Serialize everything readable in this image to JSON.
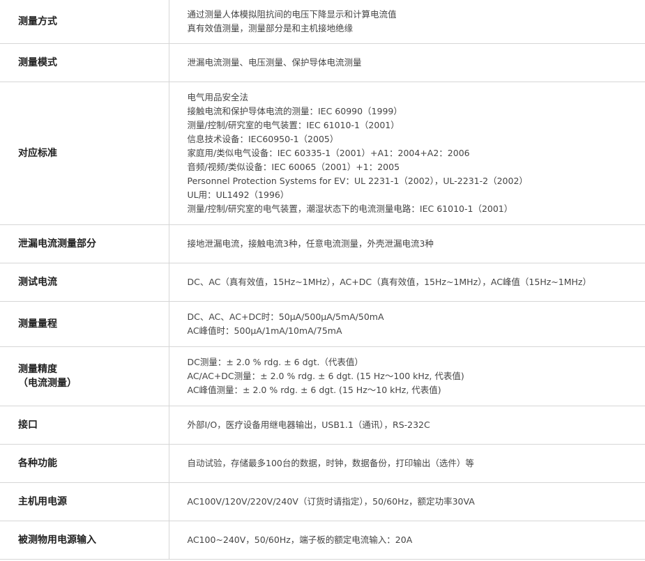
{
  "rows": [
    {
      "label": [
        "测量方式"
      ],
      "lines": [
        "通过测量人体模拟阻抗间的电压下降显示和计算电流值",
        "真有效值测量，测量部分是和主机接地绝缘"
      ]
    },
    {
      "label": [
        "测量模式"
      ],
      "lines": [
        "泄漏电流测量、电压测量、保护导体电流测量"
      ]
    },
    {
      "label": [
        "对应标准"
      ],
      "lines": [
        "电气用品安全法",
        "接触电流和保护导体电流的测量：IEC 60990（1999）",
        "测量/控制/研究室的电气装置：IEC 61010-1（2001）",
        "信息技术设备：IEC60950-1（2005）",
        "家庭用/类似电气设备：IEC 60335-1（2001）+A1：2004+A2：2006",
        "音频/视频/类似设备：IEC 60065（2001）+1：2005",
        "Personnel Protection Systems for EV：UL 2231-1（2002），UL-2231-2（2002）",
        "UL用：UL1492（1996）",
        "测量/控制/研究室的电气装置，潮湿状态下的电流测量电路：IEC 61010-1（2001）"
      ]
    },
    {
      "label": [
        "泄漏电流测量部分"
      ],
      "lines": [
        "接地泄漏电流，接触电流3种，任意电流测量，外壳泄漏电流3种"
      ]
    },
    {
      "label": [
        "测试电流"
      ],
      "lines": [
        "DC、AC（真有效值，15Hz~1MHz），AC+DC（真有效值，15Hz~1MHz），AC峰值（15Hz~1MHz）"
      ]
    },
    {
      "label": [
        "测量量程"
      ],
      "lines": [
        "DC、AC、AC+DC时：50μA/500μA/5mA/50mA",
        "AC峰值时：500μA/1mA/10mA/75mA"
      ]
    },
    {
      "label": [
        "测量精度",
        "（电流测量）"
      ],
      "lines": [
        "DC测量：± 2.0 % rdg. ± 6 dgt.（代表值）",
        "AC/AC+DC测量：± 2.0 % rdg. ± 6 dgt. (15 Hz～100 kHz, 代表值)",
        "AC峰值测量：± 2.0 % rdg. ± 6 dgt. (15 Hz～10 kHz, 代表值)"
      ]
    },
    {
      "label": [
        "接口"
      ],
      "lines": [
        "外部I/O，医疗设备用继电器输出，USB1.1（通讯），RS-232C"
      ]
    },
    {
      "label": [
        "各种功能"
      ],
      "lines": [
        "自动试验，存储最多100台的数据，时钟，数据备份，打印输出（选件）等"
      ]
    },
    {
      "label": [
        "主机用电源"
      ],
      "lines": [
        "AC100V/120V/220V/240V（订货时请指定），50/60Hz，额定功率30VA"
      ]
    },
    {
      "label": [
        "被测物用电源输入"
      ],
      "lines": [
        "AC100~240V，50/60Hz，端子板的额定电流输入：20A"
      ]
    }
  ]
}
